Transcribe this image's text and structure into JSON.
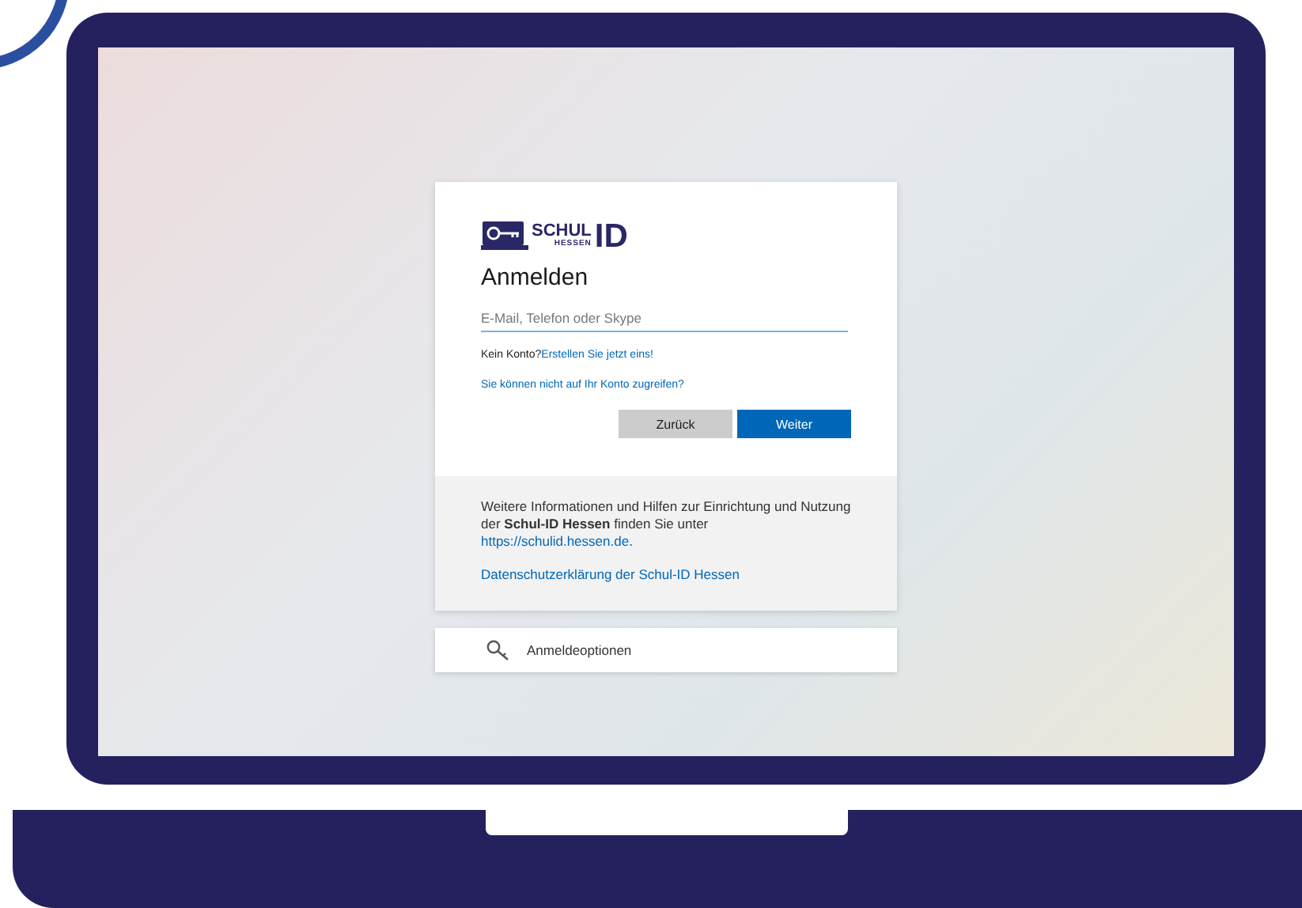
{
  "logo": {
    "word_top": "SCHUL",
    "word_bottom": "HESSEN",
    "word_big": "ID"
  },
  "heading": "Anmelden",
  "login_field": {
    "placeholder": "E-Mail, Telefon oder Skype"
  },
  "no_account": {
    "text": "Kein Konto?",
    "link": "Erstellen Sie jetzt eins!"
  },
  "access_link": "Sie können nicht auf Ihr Konto zugreifen?",
  "buttons": [
    {
      "label": "Zurück",
      "kind": "secondary"
    },
    {
      "label": "Weiter",
      "kind": "primary"
    }
  ],
  "info": {
    "text": "Weitere Informationen und Hilfen zur Einrichtung und Nutzung der **Schul-ID Hessen** finden Sie unter",
    "link": "https://schulid.hessen.de",
    "after": "."
  },
  "privacy_link": "Datenschutzerklärung der Schul-ID Hessen",
  "sign_in_options": "Anmeldeoptionen"
}
